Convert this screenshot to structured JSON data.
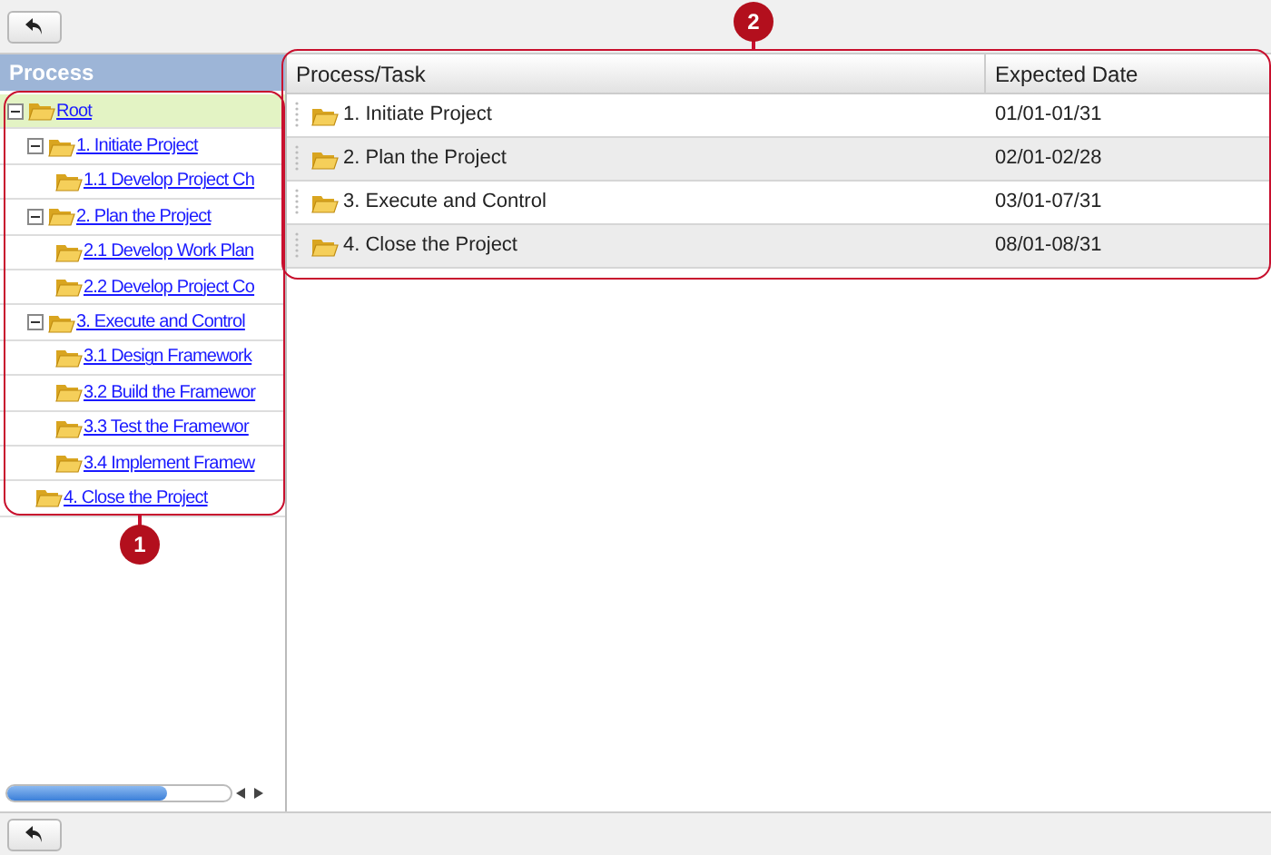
{
  "tree": {
    "title": "Process",
    "items": [
      {
        "label": "Root",
        "selected": true,
        "expanded": true,
        "children": [
          {
            "label": "1. Initiate Project",
            "selected": false,
            "expanded": true,
            "children": [
              {
                "label": "1.1 Develop Project Ch",
                "selected": false
              }
            ]
          },
          {
            "label": "2. Plan the Project",
            "selected": false,
            "expanded": true,
            "children": [
              {
                "label": "2.1 Develop Work Plan",
                "selected": false
              },
              {
                "label": "2.2 Develop Project Co",
                "selected": false
              }
            ]
          },
          {
            "label": "3. Execute and Control",
            "selected": false,
            "expanded": true,
            "children": [
              {
                "label": "3.1 Design Framework",
                "selected": false
              },
              {
                "label": "3.2 Build the Framewor",
                "selected": false
              },
              {
                "label": "3.3 Test the Framewor",
                "selected": false
              },
              {
                "label": "3.4 Implement Framew",
                "selected": false
              }
            ]
          },
          {
            "label": "4. Close the Project",
            "selected": false
          }
        ]
      }
    ]
  },
  "table": {
    "columns": [
      "Process/Task",
      "Expected Date"
    ],
    "rows": [
      {
        "task": "1. Initiate Project",
        "date": "01/01-01/31"
      },
      {
        "task": "2. Plan the Project",
        "date": "02/01-02/28"
      },
      {
        "task": "3. Execute and Control",
        "date": "03/01-07/31"
      },
      {
        "task": "4. Close the Project",
        "date": "08/01-08/31"
      }
    ]
  },
  "callouts": [
    "1",
    "2"
  ]
}
